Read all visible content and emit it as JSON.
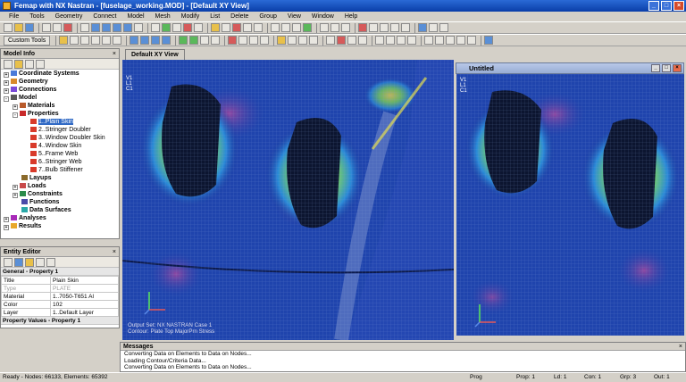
{
  "window": {
    "title": "Femap with NX Nastran - [fuselage_working.MOD] - [Default XY View]"
  },
  "menu": [
    "File",
    "Tools",
    "Geometry",
    "Connect",
    "Model",
    "Mesh",
    "Modify",
    "List",
    "Delete",
    "Group",
    "View",
    "Window",
    "Help"
  ],
  "toolbar": {
    "custom_tools_label": "Custom Tools"
  },
  "model_info": {
    "title": "Model Info",
    "tree": [
      {
        "label": "Coordinate Systems",
        "level": 0,
        "bold": true,
        "icon": "axes-icon",
        "expander": "+"
      },
      {
        "label": "Geometry",
        "level": 0,
        "bold": true,
        "icon": "geometry-icon",
        "expander": "+"
      },
      {
        "label": "Connections",
        "level": 0,
        "bold": true,
        "icon": "connection-icon",
        "expander": "+"
      },
      {
        "label": "Model",
        "level": 0,
        "bold": true,
        "icon": "model-icon",
        "expander": "-"
      },
      {
        "label": "Materials",
        "level": 1,
        "bold": true,
        "icon": "material-icon",
        "expander": "+"
      },
      {
        "label": "Properties",
        "level": 1,
        "bold": true,
        "icon": "property-icon",
        "expander": "-"
      },
      {
        "label": "1..Plain Skin",
        "level": 2,
        "bold": false,
        "icon": "beam-icon",
        "selected": true
      },
      {
        "label": "2..Stringer Doubler",
        "level": 2,
        "bold": false,
        "icon": "beam-icon"
      },
      {
        "label": "3..Window Doubler Skin",
        "level": 2,
        "bold": false,
        "icon": "beam-icon"
      },
      {
        "label": "4..Window Skin",
        "level": 2,
        "bold": false,
        "icon": "beam-icon"
      },
      {
        "label": "5..Frame Web",
        "level": 2,
        "bold": false,
        "icon": "beam-icon"
      },
      {
        "label": "6..Stringer Web",
        "level": 2,
        "bold": false,
        "icon": "beam-icon"
      },
      {
        "label": "7..Bulb Stiffener",
        "level": 2,
        "bold": false,
        "icon": "beam-icon"
      },
      {
        "label": "Layups",
        "level": 1,
        "bold": true,
        "icon": "layup-icon"
      },
      {
        "label": "Loads",
        "level": 1,
        "bold": true,
        "icon": "load-icon",
        "expander": "+"
      },
      {
        "label": "Constraints",
        "level": 1,
        "bold": true,
        "icon": "constraint-icon",
        "expander": "+"
      },
      {
        "label": "Functions",
        "level": 1,
        "bold": true,
        "icon": "function-icon"
      },
      {
        "label": "Data Surfaces",
        "level": 1,
        "bold": true,
        "icon": "surface-icon"
      },
      {
        "label": "Analyses",
        "level": 0,
        "bold": true,
        "icon": "analysis-icon",
        "expander": "+"
      },
      {
        "label": "Results",
        "level": 0,
        "bold": true,
        "icon": "results-icon",
        "expander": "+"
      }
    ]
  },
  "entity_editor": {
    "title": "Entity Editor",
    "section_general": "General - Property 1",
    "rows": [
      {
        "key": "Title",
        "value": "Plain Skin",
        "dim": false
      },
      {
        "key": "Type",
        "value": "PLATE",
        "dim": true
      },
      {
        "key": "Material",
        "value": "1..7050-T651 Al",
        "dim": false
      },
      {
        "key": "Color",
        "value": "102",
        "dim": false
      },
      {
        "key": "Layer",
        "value": "1..Default Layer",
        "dim": false
      }
    ],
    "section_values": "Property Values - Property 1"
  },
  "views": {
    "tab_label": "Default XY View",
    "untitled_title": "Untitled",
    "legend_lines": [
      "V1",
      "L1",
      "C1"
    ],
    "output_set": "Output Set: NX NASTRAN Case 1",
    "contour": "Contour: Plate Top MajorPrn Stress"
  },
  "messages": {
    "title": "Messages",
    "lines": [
      "Converting Data on Elements to Data on Nodes...",
      "Loading Contour/Criteria Data...",
      "Converting Data on Elements to Data on Nodes..."
    ]
  },
  "status": {
    "ready": "Ready - Nodes: 66133, Elements: 65392",
    "mode": "Prog",
    "prop": "Prop: 1",
    "ld": "Ld: 1",
    "con": "Con: 1",
    "grp": "Grp: 3",
    "out": "Out: 1"
  }
}
